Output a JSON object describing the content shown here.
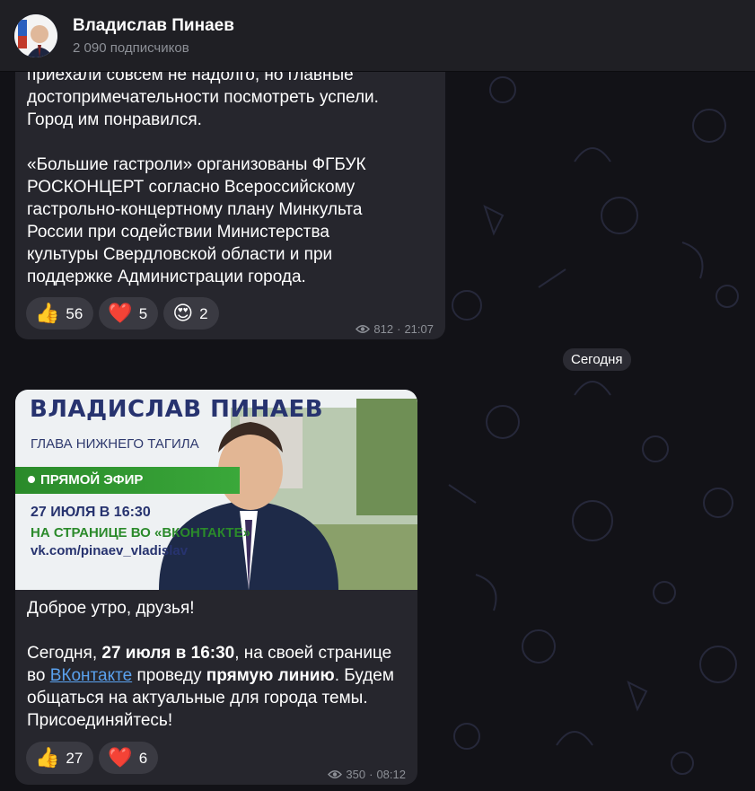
{
  "header": {
    "title": "Владислав Пинаев",
    "subtitle": "2 090 подписчиков"
  },
  "messages": [
    {
      "text": "приехали совсем не надолго, но главные\nдостопримечательности посмотреть успели.\nГород им понравился.\n\n«Большие гастроли» организованы ФГБУК\nРОСКОНЦЕРТ согласно Всероссийскому\nгастрольно-концертному плану Минкульта\nРоссии при содействии Министерства\nкультуры Свердловской области и при\nподдержке Администрации города.",
      "reactions": [
        {
          "emoji": "👍",
          "count": "56"
        },
        {
          "emoji": "❤️",
          "count": "5"
        },
        {
          "emoji": "😍",
          "count": "2"
        }
      ],
      "views": "812",
      "time": "21:07"
    },
    {
      "banner": {
        "title": "ВЛАДИСЛАВ ПИНАЕВ",
        "subtitle": "ГЛАВА НИЖНЕГО ТАГИЛА",
        "live": "ПРЯМОЙ ЭФИР",
        "date": "27 ИЮЛЯ В 16:30",
        "where": "НА СТРАНИЦЕ ВО «ВКОНТАКТЕ»",
        "url": "vk.com/pinaev_vladislav"
      },
      "greeting": "Доброе утро, друзья!",
      "p1": "Сегодня, ",
      "p1_bold": "27 июля в 16:30",
      "p2": ", на своей странице",
      "p3": "во ",
      "link": "ВКонтакте",
      "p4": " проведу ",
      "p4_bold": "прямую линию",
      "p5": ". Будем",
      "p6": "общаться на актуальные для города темы.",
      "p7": "Присоединяйтесь!",
      "reactions": [
        {
          "emoji": "👍",
          "count": "27"
        },
        {
          "emoji": "❤️",
          "count": "6"
        }
      ],
      "views": "350",
      "time": "08:12"
    }
  ],
  "date_separator": "Сегодня",
  "colors": {
    "accent": "#5aa1ee",
    "bubble": "#26262d",
    "header": "#1f1f24"
  }
}
